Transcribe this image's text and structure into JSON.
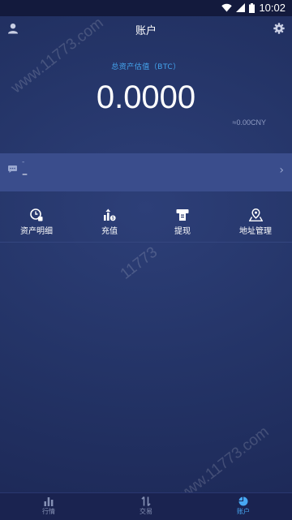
{
  "status_bar": {
    "time": "10:02",
    "icons": [
      "wifi-icon",
      "signal-icon",
      "battery-icon"
    ]
  },
  "header": {
    "title": "账户",
    "left_icon": "user-icon",
    "right_icon": "settings-icon"
  },
  "assets": {
    "total_label": "总资产估值（BTC）",
    "total_value": "0.0000",
    "cny_value": "≈0.00CNY"
  },
  "notice": {
    "icon": "message-icon",
    "small_text": "-",
    "main_text": "–",
    "chevron": "›"
  },
  "actions": [
    {
      "label": "资产明细",
      "icon": "asset-detail-icon"
    },
    {
      "label": "充值",
      "icon": "deposit-icon"
    },
    {
      "label": "提现",
      "icon": "withdraw-icon"
    },
    {
      "label": "地址管理",
      "icon": "address-icon"
    }
  ],
  "watermarks": [
    "www.11773.com",
    "11773",
    "www.11773.com"
  ],
  "tabs": [
    {
      "label": "行情",
      "icon": "market-icon",
      "active": false
    },
    {
      "label": "交易",
      "icon": "trade-icon",
      "active": false
    },
    {
      "label": "账户",
      "icon": "account-pie-icon",
      "active": true
    }
  ],
  "colors": {
    "accent": "#47a7f2",
    "background": "#243467",
    "notice_bg": "#3a4d8c"
  }
}
